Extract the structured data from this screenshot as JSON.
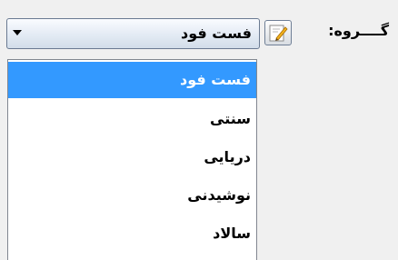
{
  "group": {
    "label": "گــــروه:",
    "selected_value": "فست فود",
    "edit_icon": "edit-pencil-icon",
    "options": [
      {
        "label": "فست فود",
        "selected": true
      },
      {
        "label": "سنتی",
        "selected": false
      },
      {
        "label": "دریایی",
        "selected": false
      },
      {
        "label": "نوشیدنی",
        "selected": false
      },
      {
        "label": "سالاد",
        "selected": false
      }
    ]
  },
  "colors": {
    "selection_highlight": "#3399ff",
    "window_background": "#f0f0f0"
  }
}
